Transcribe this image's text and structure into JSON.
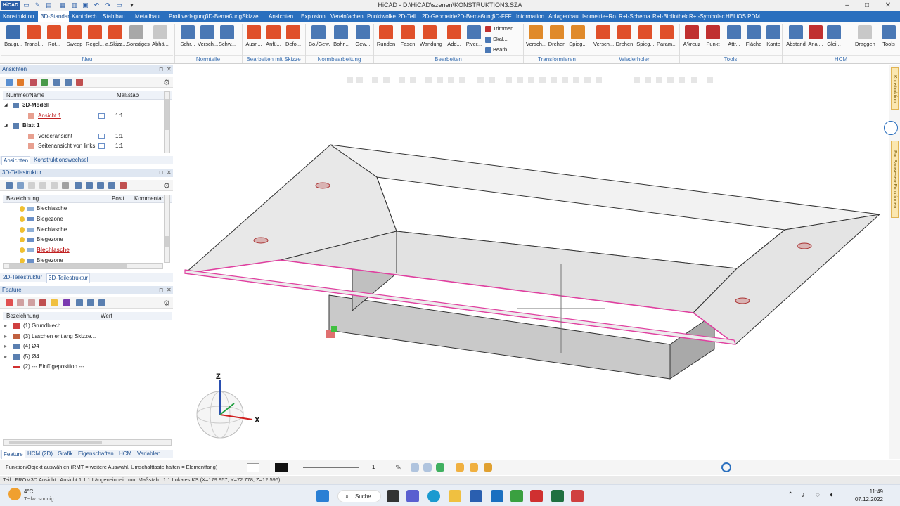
{
  "app": {
    "title": "HiCAD - D:\\HiCAD\\szenen\\KONSTRUKTION3.SZA",
    "logo": "HiCAD",
    "window_controls": [
      "–",
      "□",
      "✕"
    ]
  },
  "ribbon_tabs": [
    "Konstruktion",
    "3D-Standard",
    "Kantblech",
    "Stahlbau",
    "Metallbau",
    "Profilverlegung",
    "3D-Bemaßung",
    "Skizze",
    "Ansichten",
    "Explosion",
    "Vereinfachen",
    "Punktwolke",
    "2D-Teil",
    "2D-Geometrie",
    "2D-Bemaßung",
    "3D-FFF",
    "Information",
    "Anlagenbau",
    "Isometrie+Ro",
    "R+I-Schema",
    "R+I-Bibliothek",
    "R+I-Symbolec",
    "HELiOS PDM"
  ],
  "active_tab": "3D-Standard",
  "ribbon": {
    "buttons": [
      {
        "label": "Baugr...",
        "icon": "assembly-icon",
        "color": "#3d6fb0"
      },
      {
        "label": "Transl...",
        "icon": "translate-icon",
        "color": "#e0502a"
      },
      {
        "label": "Rot...",
        "icon": "rotate-icon",
        "color": "#e0502a"
      },
      {
        "label": "Sweep",
        "icon": "sweep-icon",
        "color": "#e0502a"
      },
      {
        "label": "Regel...",
        "icon": "ruled-surface-icon",
        "color": "#e0502a"
      },
      {
        "label": "a.Skizz...",
        "icon": "sketch-solid-icon",
        "color": "#e0502a"
      },
      {
        "label": "Sonstiges",
        "icon": "misc-icon",
        "color": "#a8a8a8"
      },
      {
        "label": "Abhä...",
        "icon": "dependency-icon",
        "color": "#c8c8c8"
      },
      {
        "label": "Schr...",
        "icon": "screw-icon",
        "color": "#4a78b5"
      },
      {
        "label": "Versch...",
        "icon": "connection-icon",
        "color": "#4a78b5"
      },
      {
        "label": "Schw...",
        "icon": "weld-icon",
        "color": "#4a78b5"
      },
      {
        "label": "Ausn...",
        "icon": "cutout-icon",
        "color": "#e0502a"
      },
      {
        "label": "Anfü...",
        "icon": "add-feature-icon",
        "color": "#e0502a"
      },
      {
        "label": "Defo...",
        "icon": "deform-icon",
        "color": "#e0502a"
      },
      {
        "label": "Bo./Gew.",
        "icon": "bore-icon",
        "color": "#4a78b5"
      },
      {
        "label": "Bohr...",
        "icon": "drill-icon",
        "color": "#4a78b5"
      },
      {
        "label": "Gew...",
        "icon": "thread-icon",
        "color": "#4a78b5"
      },
      {
        "label": "Runden",
        "icon": "fillet-icon",
        "color": "#e0502a"
      },
      {
        "label": "Fasen",
        "icon": "chamfer-icon",
        "color": "#e0502a"
      },
      {
        "label": "Wandung",
        "icon": "shell-icon",
        "color": "#e0502a"
      },
      {
        "label": "Add...",
        "icon": "add-icon",
        "color": "#e0502a"
      },
      {
        "label": "P.ver...",
        "icon": "point-move-icon",
        "color": "#4a78b5"
      },
      {
        "label": "Versch...",
        "icon": "move-icon",
        "color": "#e08a2a"
      },
      {
        "label": "Drehen",
        "icon": "turn-icon",
        "color": "#e08a2a"
      },
      {
        "label": "Spieg...",
        "icon": "mirror-icon",
        "color": "#e08a2a"
      },
      {
        "label": "Versch...",
        "icon": "repeat-move-icon",
        "color": "#e0502a"
      },
      {
        "label": "Drehen",
        "icon": "repeat-turn-icon",
        "color": "#e0502a"
      },
      {
        "label": "Spieg...",
        "icon": "repeat-mirror-icon",
        "color": "#e0502a"
      },
      {
        "label": "Param...",
        "icon": "parameter-icon",
        "color": "#e0502a"
      },
      {
        "label": "A'kreuz",
        "icon": "crosshair-icon",
        "color": "#c03030"
      },
      {
        "label": "Punkt",
        "icon": "point-icon",
        "color": "#c03030"
      },
      {
        "label": "Attr...",
        "icon": "attribute-icon",
        "color": "#4a78b5"
      },
      {
        "label": "Fläche",
        "icon": "area-icon",
        "color": "#4a78b5"
      },
      {
        "label": "Kante",
        "icon": "edge-icon",
        "color": "#4a78b5"
      },
      {
        "label": "Abstand",
        "icon": "distance-icon",
        "color": "#4a78b5"
      },
      {
        "label": "Anal...",
        "icon": "analysis-icon",
        "color": "#c03030"
      },
      {
        "label": "Glei...",
        "icon": "equal-icon",
        "color": "#4a78b5"
      },
      {
        "label": "Draggen",
        "icon": "drag-icon",
        "color": "#c8c8c8"
      },
      {
        "label": "Tools",
        "icon": "tools-icon",
        "color": "#4a78b5"
      }
    ],
    "small_buttons": [
      "Trimmen",
      "Skal...",
      "Bearb..."
    ],
    "groups": [
      "Neu",
      "Normteile",
      "Bearbeiten mit Skizze",
      "Normbearbeitung",
      "Bearbeiten",
      "Transformieren",
      "Wiederholen",
      "Tools",
      "HCM"
    ]
  },
  "ansichten_panel": {
    "title": "Ansichten",
    "columns": [
      "Nummer/Name",
      "Maßstab"
    ],
    "rows": [
      {
        "name": "3D-Modell",
        "scale": "",
        "bold": true
      },
      {
        "name": "Ansicht 1",
        "scale": "1:1",
        "active": true
      },
      {
        "name": "Blatt 1",
        "scale": "",
        "bold": true
      },
      {
        "name": "Vorderansicht",
        "scale": "1:1"
      },
      {
        "name": "Seitenansicht von links",
        "scale": "1:1"
      }
    ],
    "tabs": [
      "Ansichten",
      "Konstruktionswechsel"
    ]
  },
  "teilestruktur_panel": {
    "title": "3D-Teilestruktur",
    "columns": [
      "Bezeichnung",
      "Posit...",
      "Kommentar"
    ],
    "rows": [
      {
        "name": "Blechlasche"
      },
      {
        "name": "Biegezone"
      },
      {
        "name": "Blechlasche"
      },
      {
        "name": "Biegezone"
      },
      {
        "name": "Blechlasche",
        "active": true
      },
      {
        "name": "Biegezone"
      }
    ],
    "tabs": [
      "2D-Teilestruktur",
      "3D-Teilestruktur"
    ]
  },
  "feature_panel": {
    "title": "Feature",
    "columns": [
      "Bezeichnung",
      "Wert"
    ],
    "rows": [
      {
        "name": "(1) Grundblech"
      },
      {
        "name": "(3) Laschen entlang Skizze..."
      },
      {
        "name": "(4) Ø4"
      },
      {
        "name": "(5) Ø4"
      },
      {
        "name": "(2) --- Einfügeposition ---"
      }
    ],
    "tabs": [
      "Feature",
      "HCM (2D)",
      "Grafik",
      "Eigenschaften",
      "HCM",
      "Variablen"
    ]
  },
  "viewport": {
    "axis_x": "X",
    "axis_z": "Z",
    "highlight_color": "#e040a0"
  },
  "right_tabs": [
    "Konstruktion",
    "Fur Bauwesen-Funktionen"
  ],
  "command_prompt": "Funktion/Objekt auswählen (RMT = weitere Auswahl, Umschalttaste halten = Elementfang)",
  "bottom_line_value": "1",
  "status_line": "Teil : FROM3D   Ansicht : Ansicht 1 1:1   Längeneinheit: mm   Maßstab : 1:1   Lokales KS  (X=179.957, Y=72.778, Z=12.596)",
  "taskbar": {
    "weather_temp": "4°C",
    "weather_text": "Teilw. sonnig",
    "search": "Suche",
    "time": "11:49",
    "date": "07.12.2022"
  }
}
